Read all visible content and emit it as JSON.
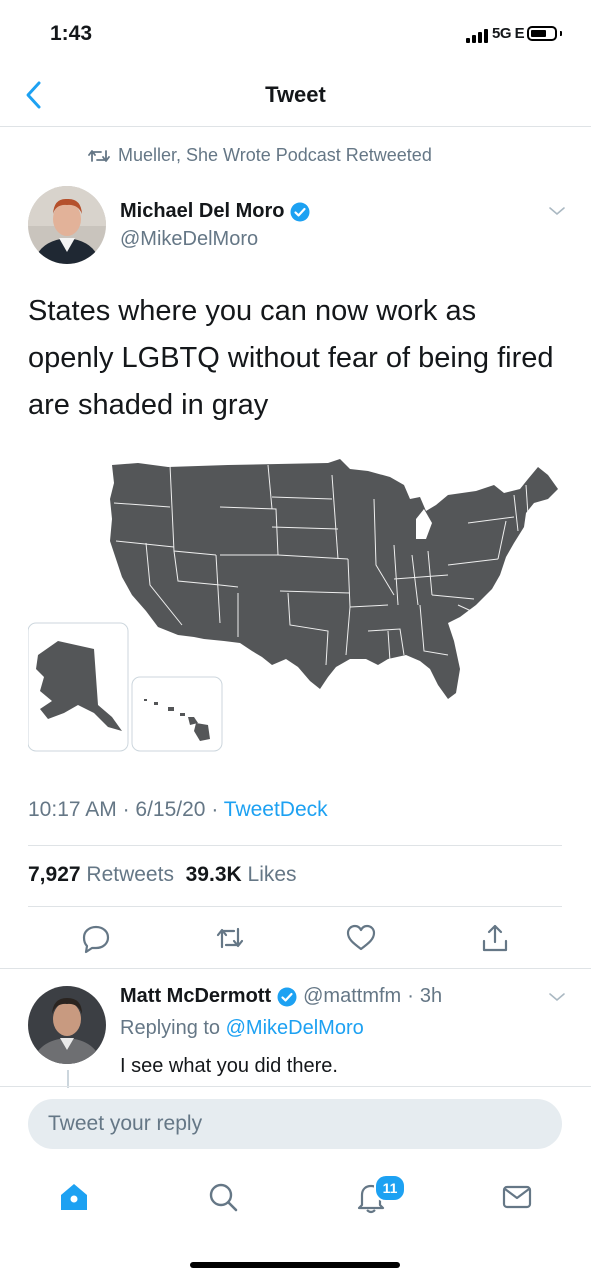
{
  "status_bar": {
    "time": "1:43",
    "network": "5G E"
  },
  "nav": {
    "title": "Tweet"
  },
  "context": {
    "retweeted_by": "Mueller, She Wrote Podcast Retweeted"
  },
  "tweet": {
    "author_name": "Michael Del Moro",
    "author_handle": "@MikeDelMoro",
    "text": "States where you can now work as openly LGBTQ without fear of being fired are shaded in gray",
    "time": "10:17 AM",
    "date": "6/15/20",
    "source": "TweetDeck",
    "retweets_count": "7,927",
    "retweets_label": "Retweets",
    "likes_count": "39.3K",
    "likes_label": "Likes",
    "image": {
      "description_icon": "us-map-image",
      "fill_color": "#545658"
    }
  },
  "reply": {
    "author_name": "Matt McDermott",
    "author_handle": "@mattmfm",
    "age": "3h",
    "replying_label": "Replying to",
    "replying_handle": "@MikeDelMoro",
    "text": "I see what you did there."
  },
  "composer": {
    "placeholder": "Tweet your reply"
  },
  "tab_bar": {
    "notifications_badge": "11"
  },
  "colors": {
    "accent": "#1da1f2",
    "secondary_text": "#657786",
    "verified": "#1da1f2"
  }
}
